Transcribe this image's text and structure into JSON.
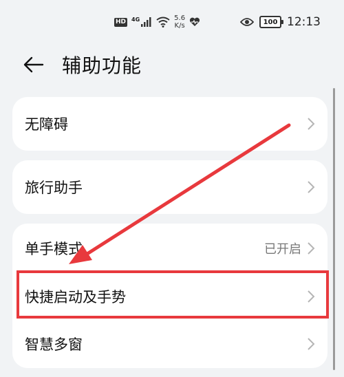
{
  "status_bar": {
    "hd": "HD",
    "network": "4G",
    "speed_value": "5.6",
    "speed_unit": "K/s",
    "battery": "100",
    "time": "12:13"
  },
  "header": {
    "title": "辅助功能"
  },
  "items": [
    {
      "label": "无障碍",
      "status": ""
    },
    {
      "label": "旅行助手",
      "status": ""
    },
    {
      "label": "单手模式",
      "status": "已开启"
    },
    {
      "label": "快捷启动及手势",
      "status": ""
    },
    {
      "label": "智慧多窗",
      "status": ""
    }
  ],
  "annotation": {
    "arrow_color": "#e8393d",
    "highlight_color": "#e8393d"
  }
}
